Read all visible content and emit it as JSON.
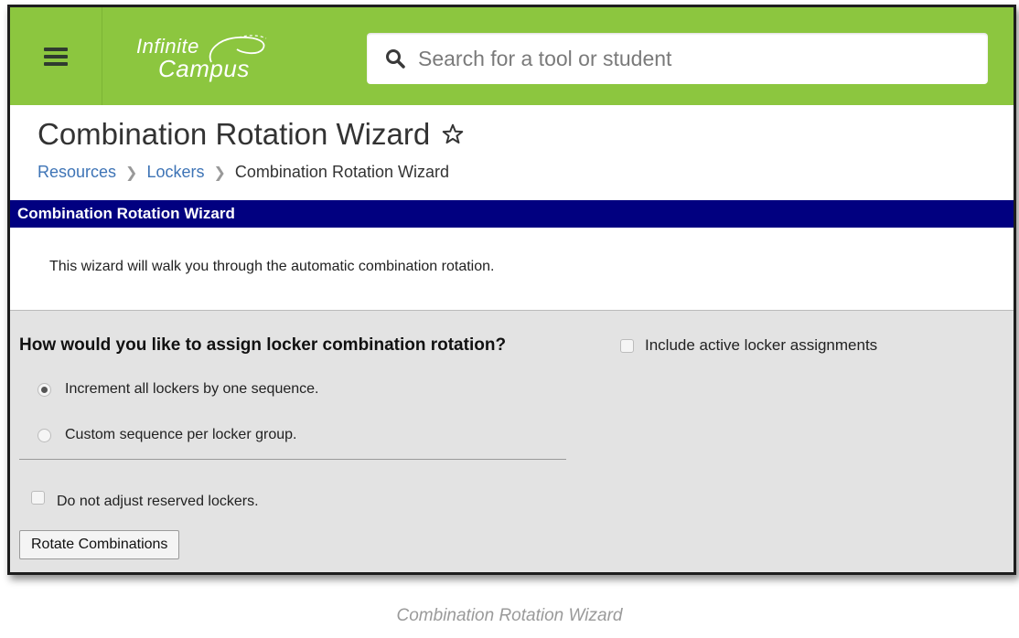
{
  "header": {
    "menu_icon": "hamburger-menu-icon",
    "logo": {
      "line1": "Infinite",
      "line2": "Campus"
    },
    "search": {
      "placeholder": "Search for a tool or student",
      "icon": "search-icon"
    },
    "brand_color": "#8cc63f"
  },
  "page": {
    "title": "Combination Rotation Wizard",
    "favorite_icon": "star-outline-icon",
    "breadcrumb": [
      "Resources",
      "Lockers",
      "Combination Rotation Wizard"
    ]
  },
  "panel": {
    "header": "Combination Rotation Wizard",
    "header_color": "#010080",
    "intro": "This wizard will walk you through the automatic combination rotation.",
    "question": "How would you like to assign locker combination rotation?",
    "options": [
      {
        "label": "Increment all lockers by one sequence.",
        "selected": true
      },
      {
        "label": "Custom sequence per locker group.",
        "selected": false
      }
    ],
    "include_active_label": "Include active locker assignments",
    "reserved_label": "Do not adjust reserved lockers.",
    "rotate_label": "Rotate Combinations"
  },
  "caption": "Combination Rotation Wizard"
}
